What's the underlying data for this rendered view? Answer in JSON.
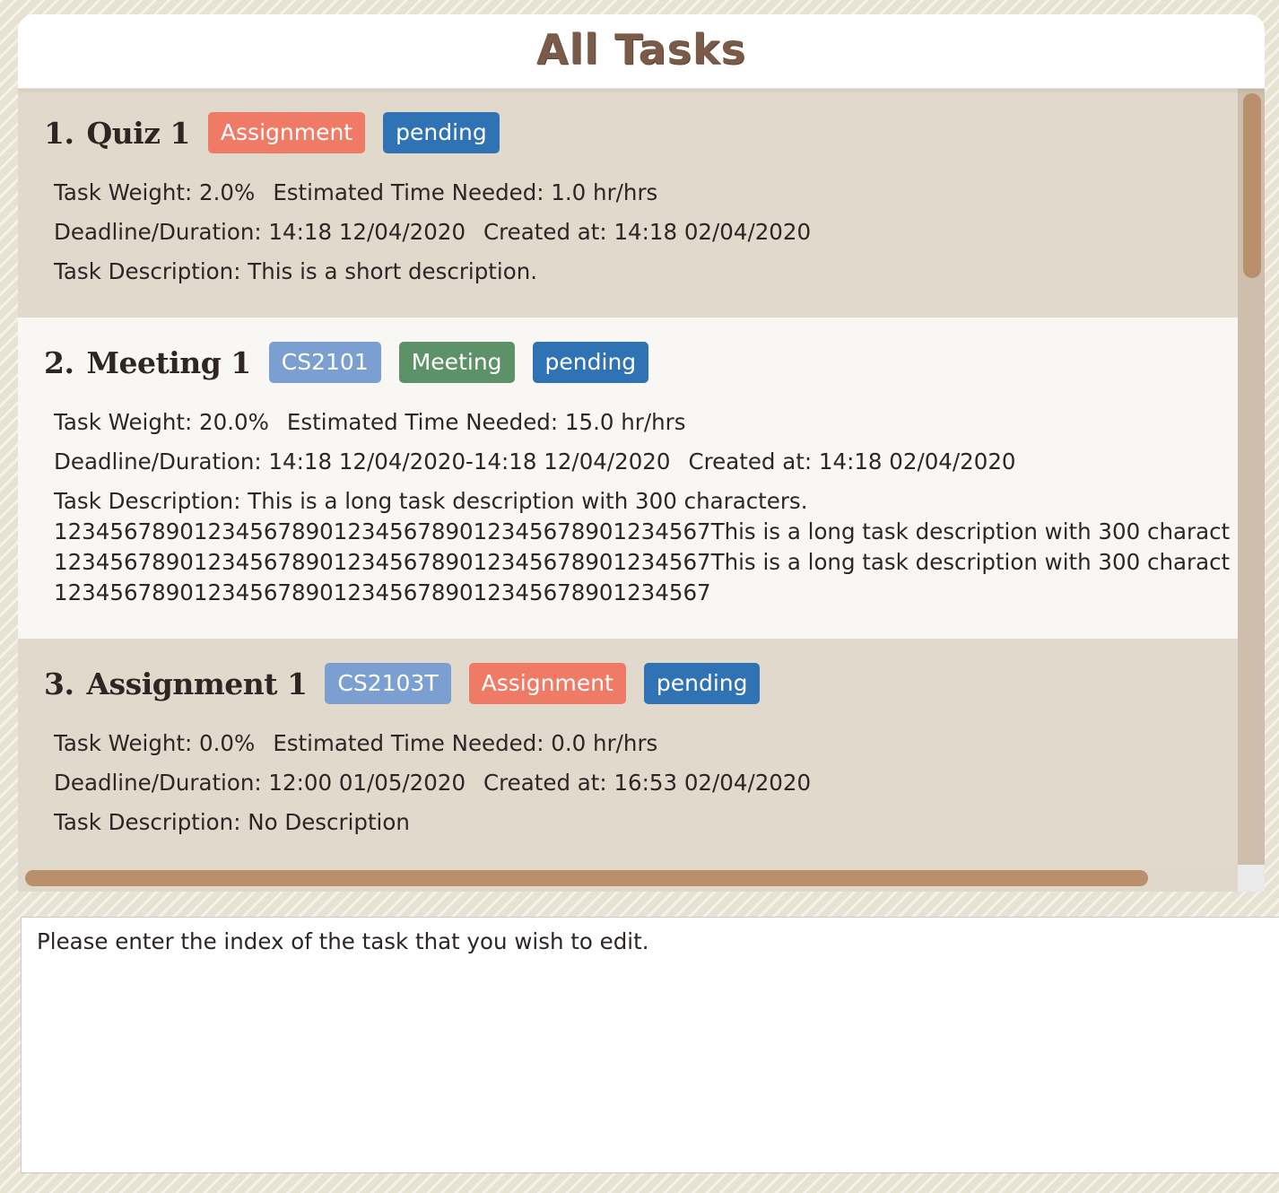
{
  "panel": {
    "title": "All Tasks"
  },
  "tasks": [
    {
      "index": "1.",
      "name": "Quiz 1",
      "tags": [
        {
          "label": "Assignment",
          "kind": "assignment"
        },
        {
          "label": "pending",
          "kind": "status"
        }
      ],
      "weight": "Task Weight: 2.0%",
      "time": "Estimated Time Needed: 1.0 hr/hrs",
      "deadline": "Deadline/Duration: 14:18 12/04/2020",
      "created": "Created at: 14:18 02/04/2020",
      "description": [
        "Task Description: This is a short description."
      ]
    },
    {
      "index": "2.",
      "name": "Meeting 1",
      "tags": [
        {
          "label": "CS2101",
          "kind": "module"
        },
        {
          "label": "Meeting",
          "kind": "meeting"
        },
        {
          "label": "pending",
          "kind": "status"
        }
      ],
      "weight": "Task Weight: 20.0%",
      "time": "Estimated Time Needed: 15.0 hr/hrs",
      "deadline": "Deadline/Duration: 14:18 12/04/2020-14:18 12/04/2020",
      "created": "Created at: 14:18 02/04/2020",
      "description": [
        "Task Description: This is a long task description with 300 characters.",
        "1234567890123456789012345678901234567890​1234567This is a long task description with 300 charact",
        "1234567890123456789012345678901234567890​1234567This is a long task description with 300 charact",
        "1234567890123456789012345678901234567890​1234567"
      ]
    },
    {
      "index": "3.",
      "name": "Assignment 1",
      "tags": [
        {
          "label": "CS2103T",
          "kind": "module"
        },
        {
          "label": "Assignment",
          "kind": "assignment"
        },
        {
          "label": "pending",
          "kind": "status"
        }
      ],
      "weight": "Task Weight: 0.0%",
      "time": "Estimated Time Needed: 0.0 hr/hrs",
      "deadline": "Deadline/Duration: 12:00 01/05/2020",
      "created": "Created at: 16:53 02/04/2020",
      "description": [
        "Task Description: No Description"
      ]
    }
  ],
  "result_display": {
    "text": "Please enter the index of the task that you wish to edit."
  },
  "colors": {
    "assignment": "#ef7a66",
    "status": "#2f73b4",
    "module": "#7a9fd0",
    "meeting": "#5d9168",
    "title": "#7a5a48",
    "scroll_thumb": "#b98f6c"
  }
}
